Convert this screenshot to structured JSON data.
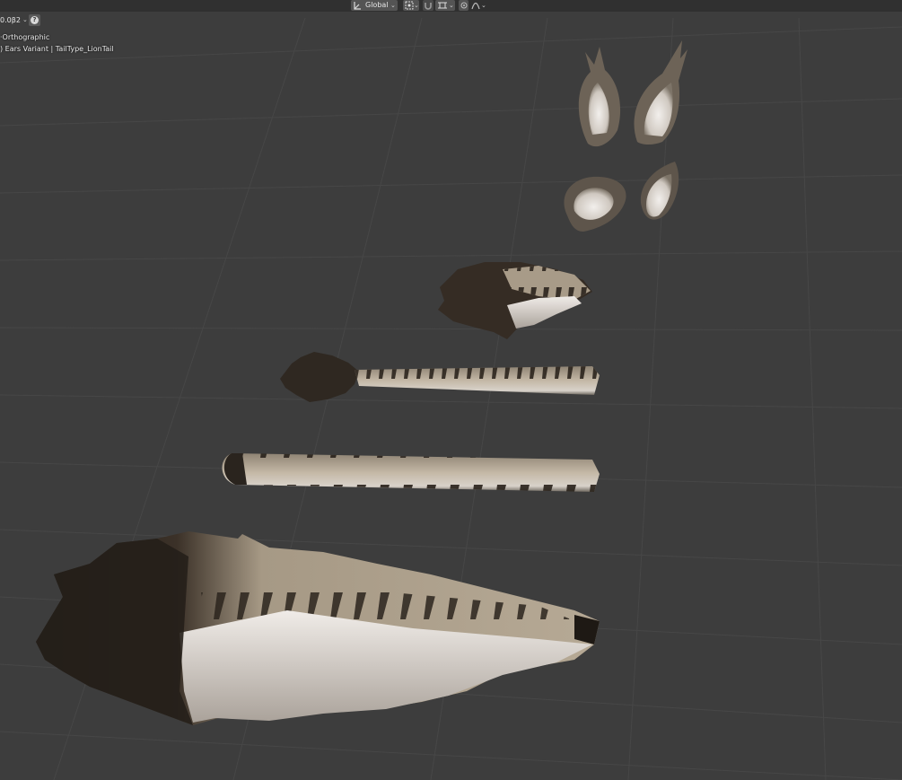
{
  "header": {
    "orientation_label": "Global",
    "snap_value": "0.0β2"
  },
  "overlay": {
    "view_label": "Orthographic",
    "collection_label": ") Ears Variant | TailType_LionTail"
  },
  "icons": {
    "transform_orientation": "transform-orientation-icon",
    "pivot": "pivot-point-icon",
    "snap": "snap-icon",
    "snap_target": "snap-target-icon",
    "proportional": "proportional-editing-icon",
    "falloff": "falloff-curve-icon",
    "help": "help-icon"
  },
  "colors": {
    "viewport_bg": "#3d3d3d",
    "header_bg": "#303030",
    "fur_light": "#b8ab98",
    "fur_dark": "#2a241e",
    "fur_white": "#e8e4e0"
  }
}
